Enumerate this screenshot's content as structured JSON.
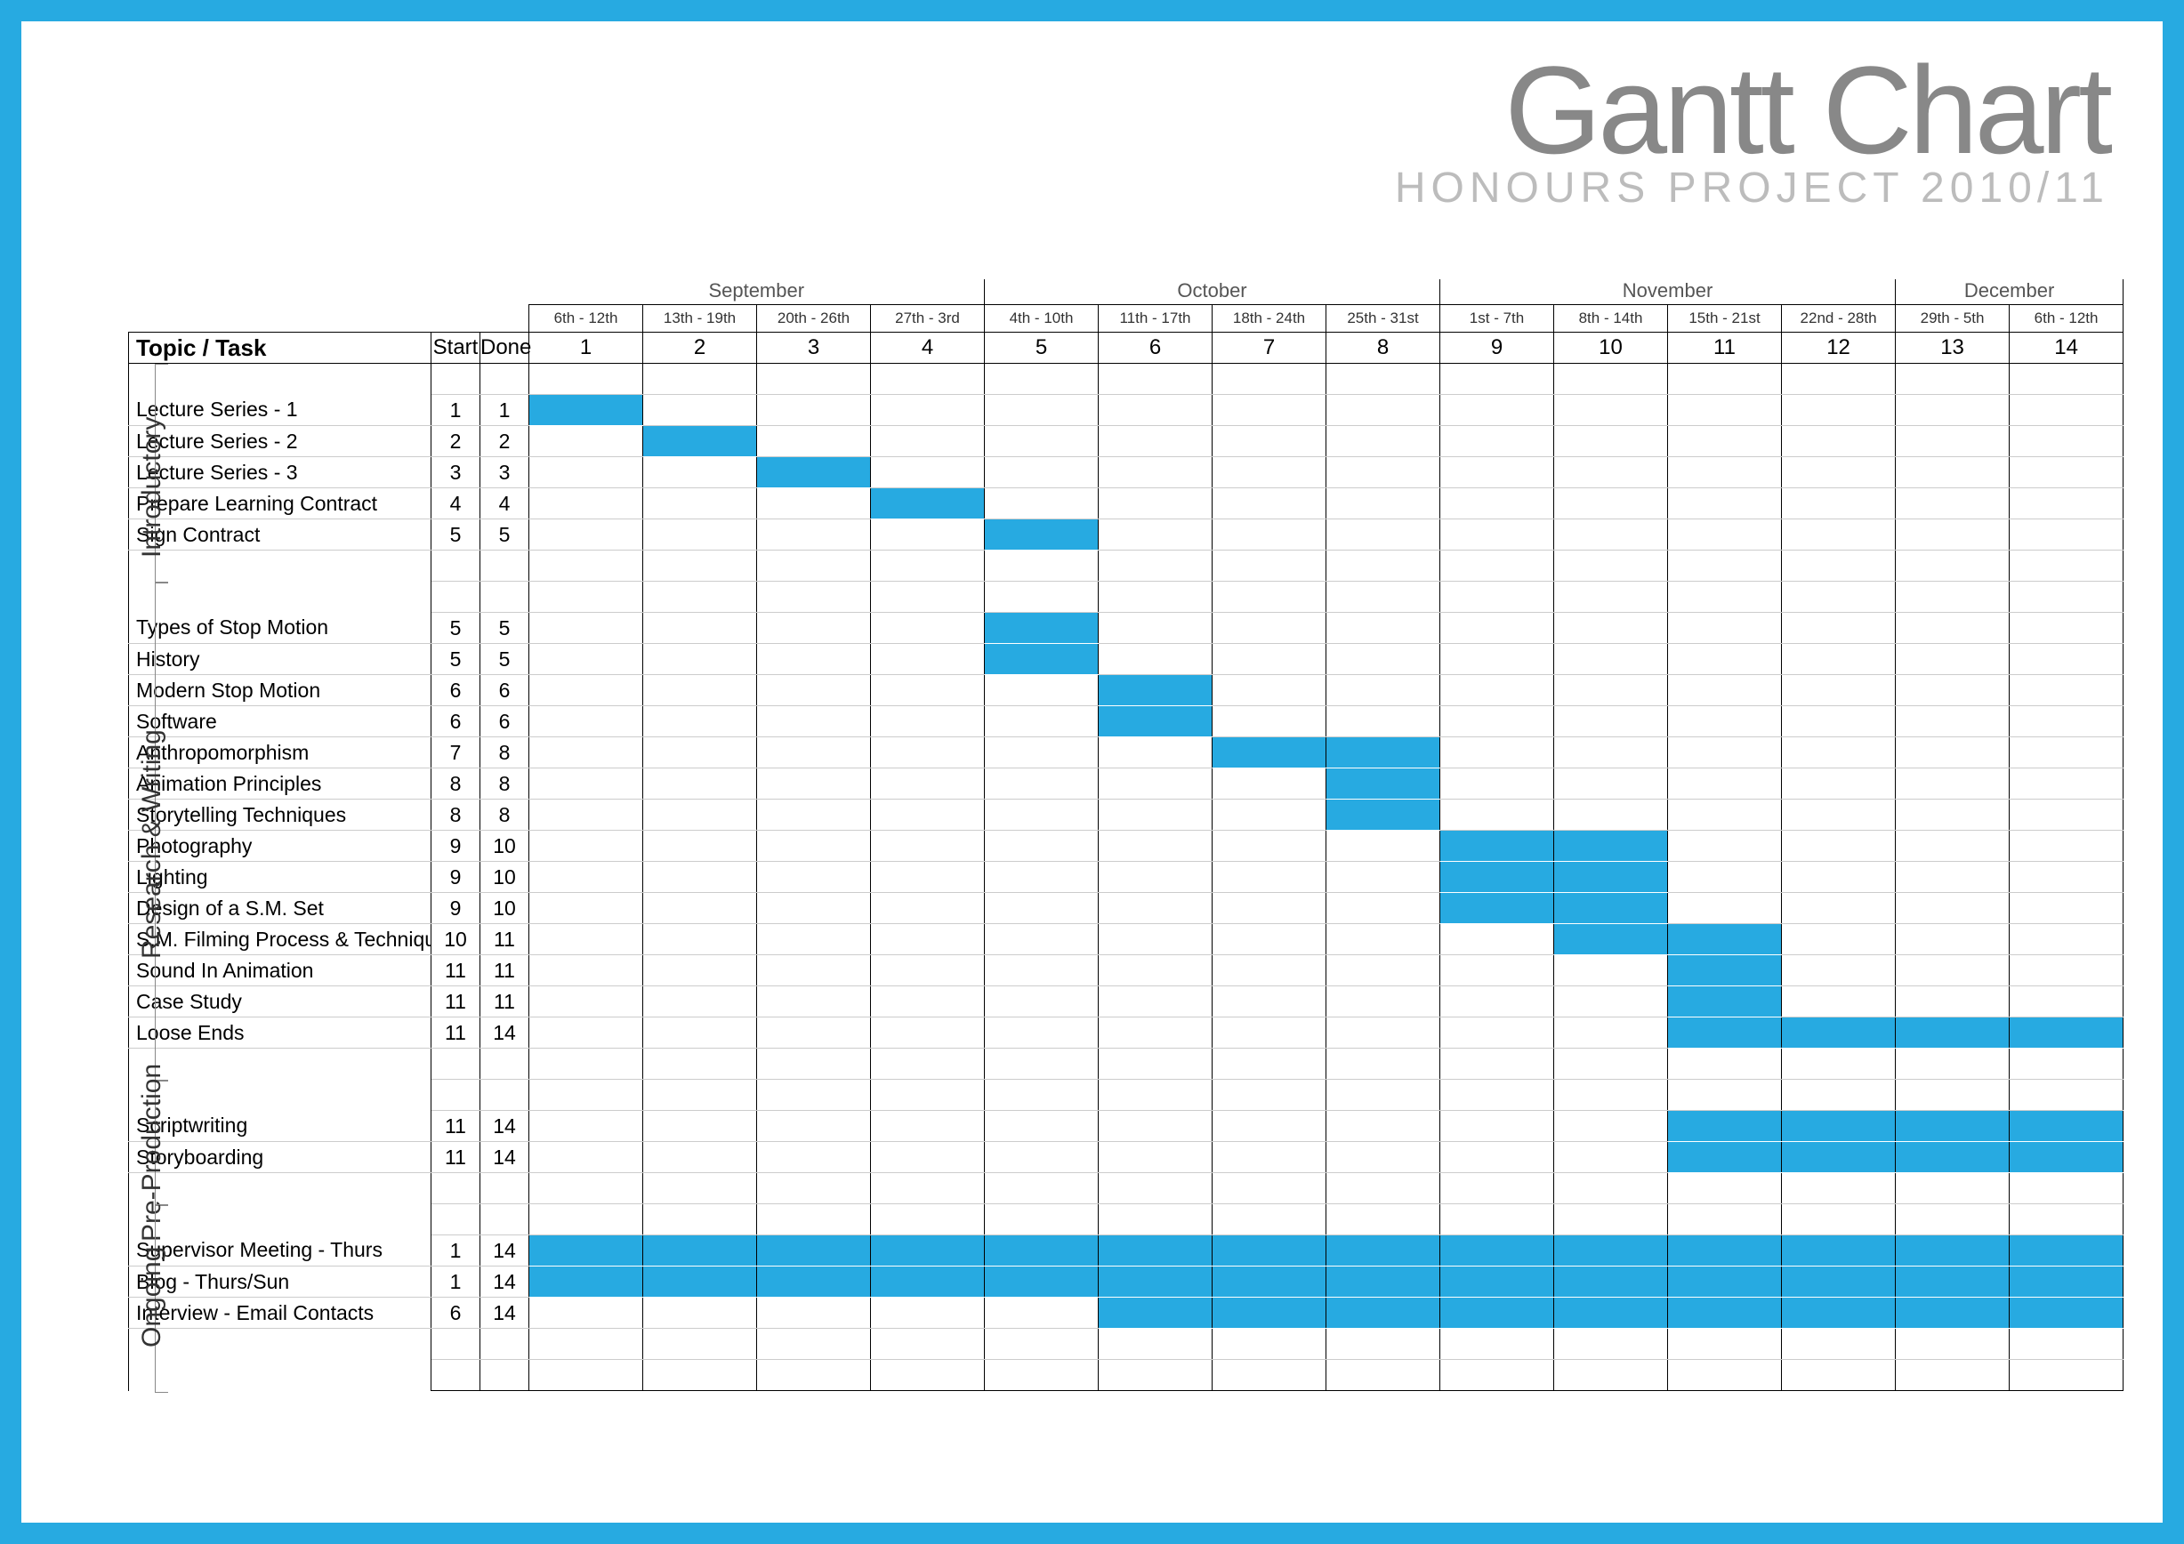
{
  "title": {
    "main": "Gantt Chart",
    "sub": "HONOURS PROJECT 2010/11"
  },
  "columns": {
    "task": "Topic / Task",
    "start": "Start",
    "done": "Done"
  },
  "months": [
    {
      "name": "September",
      "span": 4
    },
    {
      "name": "October",
      "span": 4
    },
    {
      "name": "November",
      "span": 4
    },
    {
      "name": "December",
      "span": 2
    }
  ],
  "weeks": [
    {
      "n": 1,
      "range": "6th - 12th"
    },
    {
      "n": 2,
      "range": "13th - 19th"
    },
    {
      "n": 3,
      "range": "20th - 26th"
    },
    {
      "n": 4,
      "range": "27th - 3rd"
    },
    {
      "n": 5,
      "range": "4th - 10th"
    },
    {
      "n": 6,
      "range": "11th - 17th"
    },
    {
      "n": 7,
      "range": "18th - 24th"
    },
    {
      "n": 8,
      "range": "25th - 31st"
    },
    {
      "n": 9,
      "range": "1st - 7th"
    },
    {
      "n": 10,
      "range": "8th - 14th"
    },
    {
      "n": 11,
      "range": "15th - 21st"
    },
    {
      "n": 12,
      "range": "22nd - 28th"
    },
    {
      "n": 13,
      "range": "29th - 5th"
    },
    {
      "n": 14,
      "range": "6th - 12th"
    }
  ],
  "groups": [
    {
      "name": "Introductory",
      "rows": [
        {
          "blank": true
        },
        {
          "task": "Lecture Series - 1",
          "start": 1,
          "done": 1
        },
        {
          "task": "Lecture Series - 2",
          "start": 2,
          "done": 2
        },
        {
          "task": "Lecture Series - 3",
          "start": 3,
          "done": 3
        },
        {
          "task": "Prepare Learning Contract",
          "start": 4,
          "done": 4
        },
        {
          "task": "Sign Contract",
          "start": 5,
          "done": 5
        },
        {
          "blank": true
        }
      ]
    },
    {
      "name": "Research & Writing",
      "rows": [
        {
          "blank": true
        },
        {
          "task": "Types of Stop Motion",
          "start": 5,
          "done": 5
        },
        {
          "task": "History",
          "start": 5,
          "done": 5
        },
        {
          "task": "Modern Stop Motion",
          "start": 6,
          "done": 6
        },
        {
          "task": "Software",
          "start": 6,
          "done": 6
        },
        {
          "task": "Anthropomorphism",
          "start": 7,
          "done": 8
        },
        {
          "task": "Animation Principles",
          "start": 8,
          "done": 8
        },
        {
          "task": "Storytelling Techniques",
          "start": 8,
          "done": 8
        },
        {
          "task": "Photography",
          "start": 9,
          "done": 10
        },
        {
          "task": "Lighting",
          "start": 9,
          "done": 10
        },
        {
          "task": "Design of a S.M. Set",
          "start": 9,
          "done": 10
        },
        {
          "task": "S.M. Filming Process & Techniques",
          "start": 10,
          "done": 11
        },
        {
          "task": "Sound In Animation",
          "start": 11,
          "done": 11
        },
        {
          "task": "Case Study",
          "start": 11,
          "done": 11
        },
        {
          "task": "Loose Ends",
          "start": 11,
          "done": 14
        },
        {
          "blank": true
        }
      ]
    },
    {
      "name": "Pre-Production",
      "rows": [
        {
          "blank": true
        },
        {
          "task": "Scriptwriting",
          "start": 11,
          "done": 14
        },
        {
          "task": "Storyboarding",
          "start": 11,
          "done": 14
        },
        {
          "blank": true
        }
      ]
    },
    {
      "name": "Ongoing",
      "rows": [
        {
          "blank": true
        },
        {
          "task": "Supervisor Meeting - Thurs",
          "start": 1,
          "done": 14
        },
        {
          "task": "Blog - Thurs/Sun",
          "start": 1,
          "done": 14
        },
        {
          "task": "Interview - Email Contacts",
          "start": 6,
          "done": 14
        },
        {
          "blank": true
        },
        {
          "blank": true,
          "last": true
        }
      ]
    }
  ],
  "chart_data": {
    "type": "gantt",
    "title": "Gantt Chart — Honours Project 2010/11",
    "x_unit": "week",
    "x_categories": [
      1,
      2,
      3,
      4,
      5,
      6,
      7,
      8,
      9,
      10,
      11,
      12,
      13,
      14
    ],
    "x_ranges": [
      "6th-12th Sep",
      "13th-19th Sep",
      "20th-26th Sep",
      "27th Sep-3rd Oct",
      "4th-10th Oct",
      "11th-17th Oct",
      "18th-24th Oct",
      "25th-31st Oct",
      "1st-7th Nov",
      "8th-14th Nov",
      "15th-21st Nov",
      "22nd-28th Nov",
      "29th Nov-5th Dec",
      "6th-12th Dec"
    ],
    "tasks": [
      {
        "group": "Introductory",
        "name": "Lecture Series - 1",
        "start": 1,
        "end": 1
      },
      {
        "group": "Introductory",
        "name": "Lecture Series - 2",
        "start": 2,
        "end": 2
      },
      {
        "group": "Introductory",
        "name": "Lecture Series - 3",
        "start": 3,
        "end": 3
      },
      {
        "group": "Introductory",
        "name": "Prepare Learning Contract",
        "start": 4,
        "end": 4
      },
      {
        "group": "Introductory",
        "name": "Sign Contract",
        "start": 5,
        "end": 5
      },
      {
        "group": "Research & Writing",
        "name": "Types of Stop Motion",
        "start": 5,
        "end": 5
      },
      {
        "group": "Research & Writing",
        "name": "History",
        "start": 5,
        "end": 5
      },
      {
        "group": "Research & Writing",
        "name": "Modern Stop Motion",
        "start": 6,
        "end": 6
      },
      {
        "group": "Research & Writing",
        "name": "Software",
        "start": 6,
        "end": 6
      },
      {
        "group": "Research & Writing",
        "name": "Anthropomorphism",
        "start": 7,
        "end": 8
      },
      {
        "group": "Research & Writing",
        "name": "Animation Principles",
        "start": 8,
        "end": 8
      },
      {
        "group": "Research & Writing",
        "name": "Storytelling Techniques",
        "start": 8,
        "end": 8
      },
      {
        "group": "Research & Writing",
        "name": "Photography",
        "start": 9,
        "end": 10
      },
      {
        "group": "Research & Writing",
        "name": "Lighting",
        "start": 9,
        "end": 10
      },
      {
        "group": "Research & Writing",
        "name": "Design of a S.M. Set",
        "start": 9,
        "end": 10
      },
      {
        "group": "Research & Writing",
        "name": "S.M. Filming Process & Techniques",
        "start": 10,
        "end": 11
      },
      {
        "group": "Research & Writing",
        "name": "Sound In Animation",
        "start": 11,
        "end": 11
      },
      {
        "group": "Research & Writing",
        "name": "Case Study",
        "start": 11,
        "end": 11
      },
      {
        "group": "Research & Writing",
        "name": "Loose Ends",
        "start": 11,
        "end": 14
      },
      {
        "group": "Pre-Production",
        "name": "Scriptwriting",
        "start": 11,
        "end": 14
      },
      {
        "group": "Pre-Production",
        "name": "Storyboarding",
        "start": 11,
        "end": 14
      },
      {
        "group": "Ongoing",
        "name": "Supervisor Meeting - Thurs",
        "start": 1,
        "end": 14
      },
      {
        "group": "Ongoing",
        "name": "Blog - Thurs/Sun",
        "start": 1,
        "end": 14
      },
      {
        "group": "Ongoing",
        "name": "Interview - Email Contacts",
        "start": 6,
        "end": 14
      }
    ]
  }
}
